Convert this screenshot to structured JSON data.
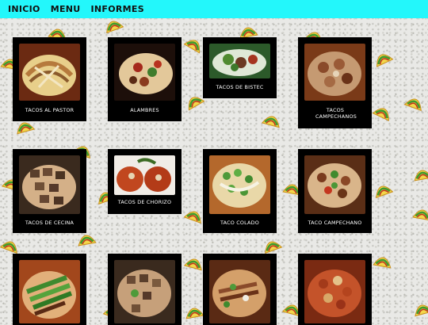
{
  "nav": {
    "items": [
      "INICIO",
      "MENU",
      "INFORMES"
    ]
  },
  "menu": {
    "items": [
      {
        "label": "TACOS AL PASTOR",
        "icon": "tacos-al-pastor-photo"
      },
      {
        "label": "ALAMBRES",
        "icon": "alambres-photo"
      },
      {
        "label": "TACOS DE BISTEC",
        "icon": "tacos-de-bistec-photo"
      },
      {
        "label": "TACOS CAMPECHANOS",
        "icon": "tacos-campechanos-photo"
      },
      {
        "label": "TACOS DE CECINA",
        "icon": "tacos-de-cecina-photo"
      },
      {
        "label": "TACOS DE CHORIZO",
        "icon": "tacos-de-chorizo-photo"
      },
      {
        "label": "TACO COLADO",
        "icon": "taco-colado-photo"
      },
      {
        "label": "TACO CAMPECHANO",
        "icon": "taco-campechano-photo"
      },
      {
        "label": "",
        "icon": "taco-green-chile-photo"
      },
      {
        "label": "",
        "icon": "taco-meat-mix-photo"
      },
      {
        "label": "",
        "icon": "taco-shredded-photo"
      },
      {
        "label": "",
        "icon": "taco-pastor-close-photo"
      }
    ]
  },
  "colors": {
    "topbar": "#23f7fb",
    "card": "#000000",
    "label": "#ffffff"
  }
}
